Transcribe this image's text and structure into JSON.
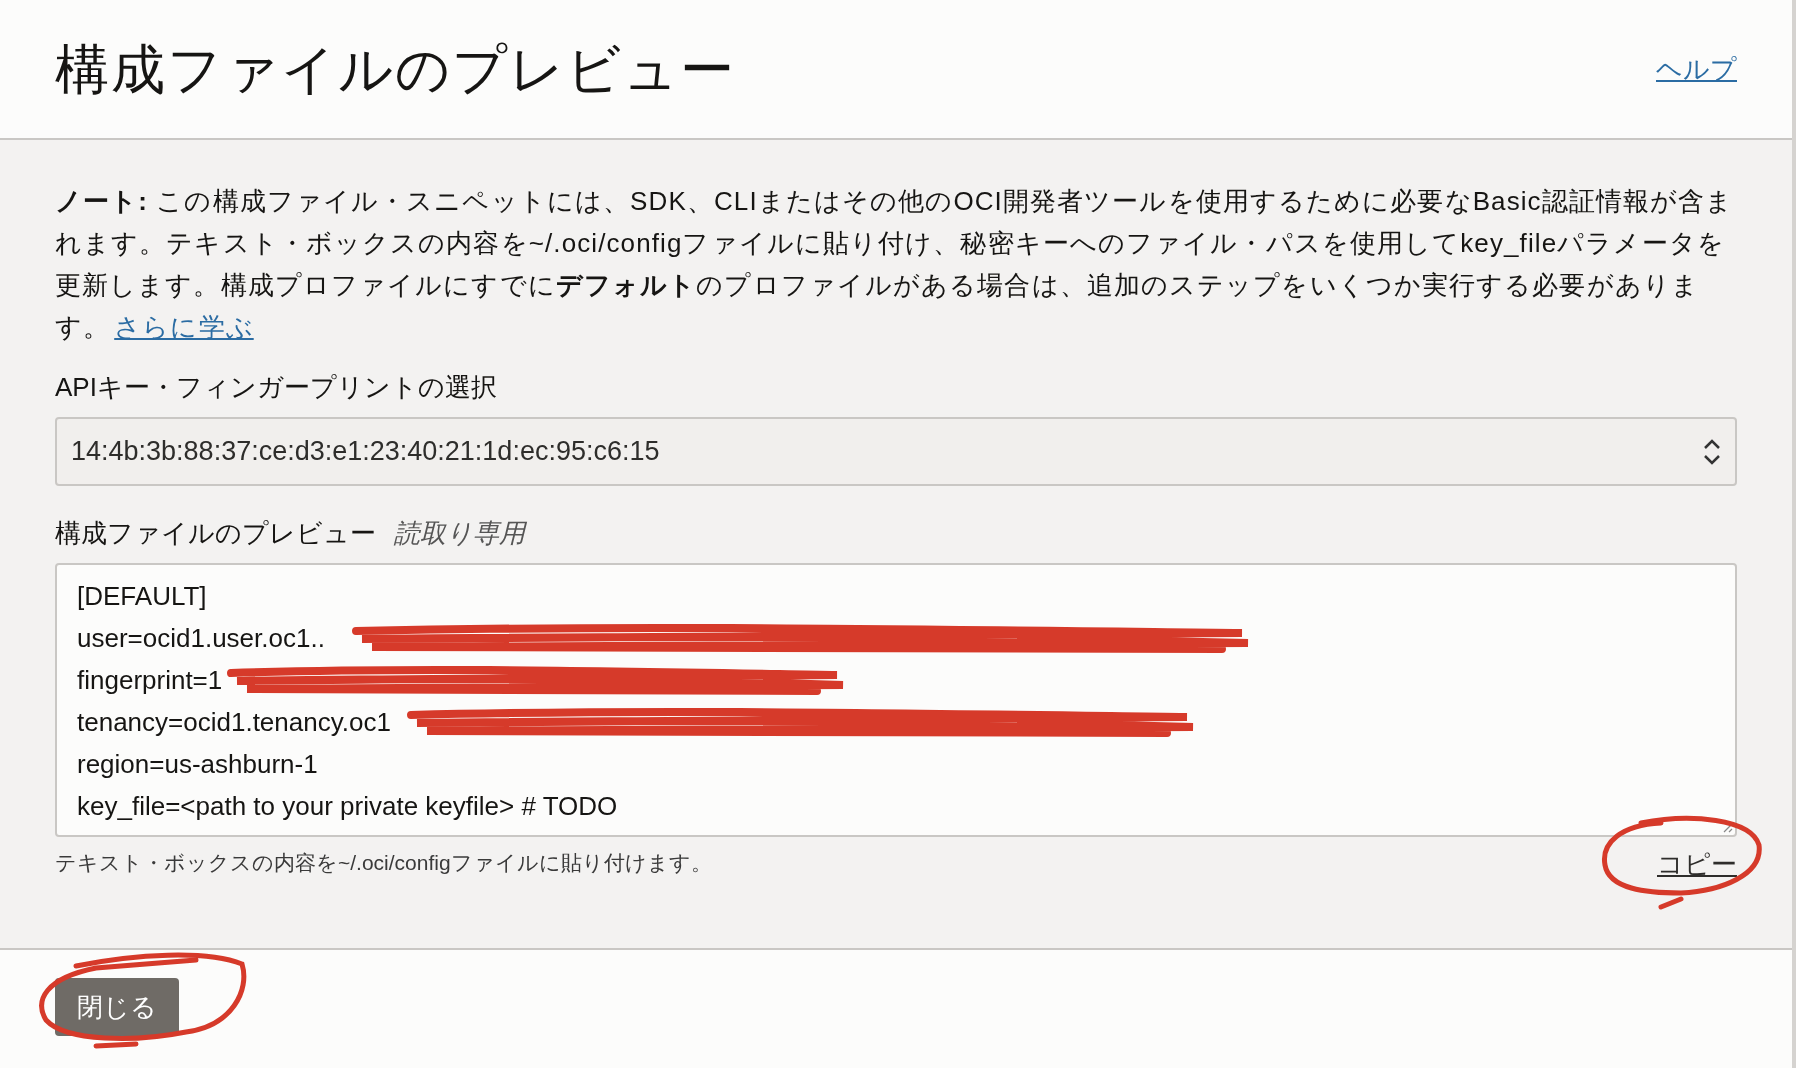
{
  "dialog": {
    "title": "構成ファイルのプレビュー",
    "help_link": "ヘルプ"
  },
  "note": {
    "text": "**ノート:** この構成ファイル・スニペットには、SDK、CLIまたはその他のOCI開発者ツールを使用するために必要なBasic認証情報が含まれます。テキスト・ボックスの内容を~/.oci/configファイルに貼り付け、秘密キーへのファイル・パスを使用してkey_fileパラメータを更新します。構成プロファイルにすでに**デフォルト**のプロファイルがある場合は、追加のステップをいくつか実行する必要があります。",
    "link": "さらに学ぶ"
  },
  "fingerprint_select": {
    "label": "APIキー・フィンガープリントの選択",
    "value": "14:4b:3b:88:37:ce:d3:e1:23:40:21:1d:ec:95:c6:15"
  },
  "preview": {
    "label": "構成ファイルのプレビュー",
    "badge": "読取り専用",
    "lines": [
      {
        "text": "[DEFAULT]",
        "redacted": false
      },
      {
        "text": "user=ocid1.user.oc1..",
        "redacted": true
      },
      {
        "text": "fingerprint=1",
        "redacted": true
      },
      {
        "text": "tenancy=ocid1.tenancy.oc1",
        "redacted": true
      },
      {
        "text": "region=us-ashburn-1",
        "redacted": false
      },
      {
        "text": "key_file=<path to your private keyfile> # TODO",
        "redacted": false
      }
    ],
    "hint": "テキスト・ボックスの内容を~/.oci/configファイルに貼り付けます。",
    "copy_link": "コピー",
    "copy_circled": true
  },
  "footer": {
    "close_button": "閉じる",
    "close_circled": true
  }
}
